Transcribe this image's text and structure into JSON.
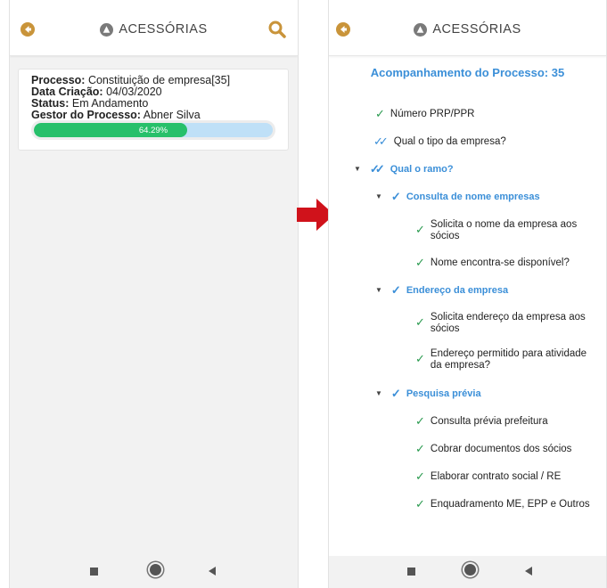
{
  "app": {
    "brand": "ACESSÓRIAS"
  },
  "card": {
    "process_label": "Processo:",
    "process_value": "Constituição de empresa[35]",
    "created_label": "Data Criação:",
    "created_value": "04/03/2020",
    "status_label": "Status:",
    "status_value": "Em Andamento",
    "manager_label": "Gestor do Processo:",
    "manager_value": "Abner Silva",
    "progress_text": "64.29%",
    "progress_fraction": 0.6429
  },
  "tracking": {
    "title": "Acompanhamento do Processo: 35",
    "items": [
      {
        "text": "Número PRP/PPR"
      },
      {
        "text": "Qual o tipo da empresa?"
      },
      {
        "text": "Qual o ramo?"
      },
      {
        "text": "Consulta de nome empresas"
      },
      {
        "text": "Solicita o nome da empresa aos sócios"
      },
      {
        "text": "Nome encontra-se disponível?"
      },
      {
        "text": "Endereço da empresa"
      },
      {
        "text": "Solicita endereço da empresa aos sócios"
      },
      {
        "text": "Endereço permitido para atividade da empresa?"
      },
      {
        "text": "Pesquisa prévia"
      },
      {
        "text": "Consulta prévia prefeitura"
      },
      {
        "text": "Cobrar documentos dos sócios"
      },
      {
        "text": "Elaborar contrato social / RE"
      },
      {
        "text": "Enquadramento ME, EPP e Outros"
      }
    ]
  },
  "colors": {
    "accent_gold": "#c9943a",
    "link_blue": "#3b8fd8",
    "check_green": "#2a9a4f",
    "progress_green": "#27c06a",
    "progress_track": "#bfe0f7",
    "arrow_red": "#d0121b"
  },
  "icons": [
    "back-icon",
    "logo-icon",
    "search-icon",
    "check-icon",
    "double-check-icon",
    "caret-down-icon",
    "nav-square-icon",
    "nav-home-icon",
    "nav-back-icon",
    "arrow-right-icon"
  ]
}
